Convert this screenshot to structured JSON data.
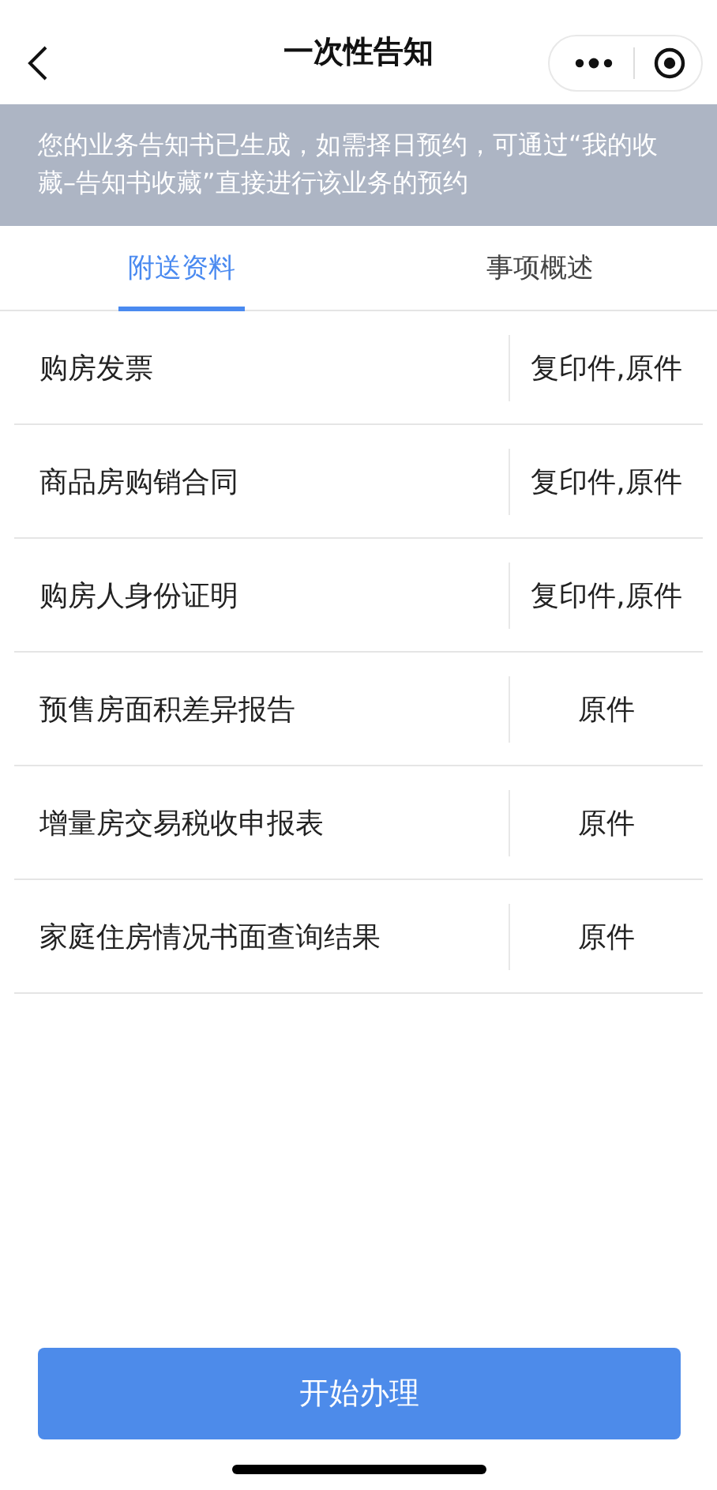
{
  "header": {
    "title": "一次性告知"
  },
  "notice": "您的业务告知书已生成，如需择日预约，可通过“我的收藏–告知书收藏”直接进行该业务的预约",
  "tabs": [
    {
      "label": "附送资料",
      "selected": true
    },
    {
      "label": "事项概述",
      "selected": false
    }
  ],
  "materials": [
    {
      "name": "购房发票",
      "form": "复印件,原件"
    },
    {
      "name": "商品房购销合同",
      "form": "复印件,原件"
    },
    {
      "name": "购房人身份证明",
      "form": "复印件,原件"
    },
    {
      "name": "预售房面积差异报告",
      "form": "原件"
    },
    {
      "name": "增量房交易税收申报表",
      "form": "原件"
    },
    {
      "name": "家庭住房情况书面查询结果",
      "form": "原件"
    }
  ],
  "primary_button": "开始办理"
}
